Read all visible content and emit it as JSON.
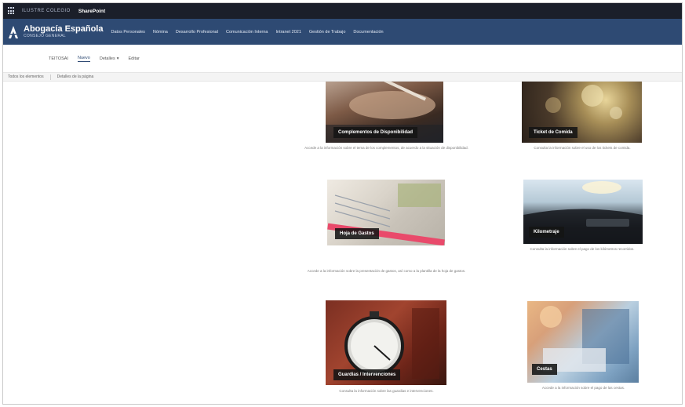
{
  "suite": {
    "brand": "ILUSTRE COLEGIO",
    "app": "SharePoint"
  },
  "site": {
    "title": "Abogacía Española",
    "subtitle": "CONSEJO GENERAL",
    "nav": [
      "Datos Personales",
      "Nómina",
      "Desarrollo Profesional",
      "Comunicación Interna",
      "Intranet 2021",
      "Gestión de Trabajo",
      "Documentación"
    ]
  },
  "pagetabs": {
    "items": [
      "TEITOSAI",
      "Nuevo",
      "Detalles",
      "Editar"
    ]
  },
  "cmdbar": {
    "items": [
      "Todos los elementos",
      "Detalles de la página"
    ]
  },
  "tiles": [
    {
      "label": "Complementos de Disponibilidad",
      "desc": "Accede a la información sobre el tema de los complementos, de acuerdo a la situación de disponibilidad."
    },
    {
      "label": "Ticket de Comida",
      "desc": "Consulta la información sobre el uso de los tickets de comida."
    },
    {
      "label": "Hoja de Gastos",
      "desc": "Accede a la información sobre la presentación de gastos, así como a la plantilla de la hoja de gastos."
    },
    {
      "label": "Kilometraje",
      "desc": "Consulta la información sobre el pago de los kilómetros recorridos."
    },
    {
      "label": "Guardias / Intervenciones",
      "desc": "Consulta la información sobre las guardias e intervenciones."
    },
    {
      "label": "Cestas",
      "desc": "Accede a la información sobre el pago de las cestas."
    }
  ],
  "colors": {
    "suitebar": "#1b1f2a",
    "header": "#2e4a73",
    "label_bg": "#141414"
  }
}
